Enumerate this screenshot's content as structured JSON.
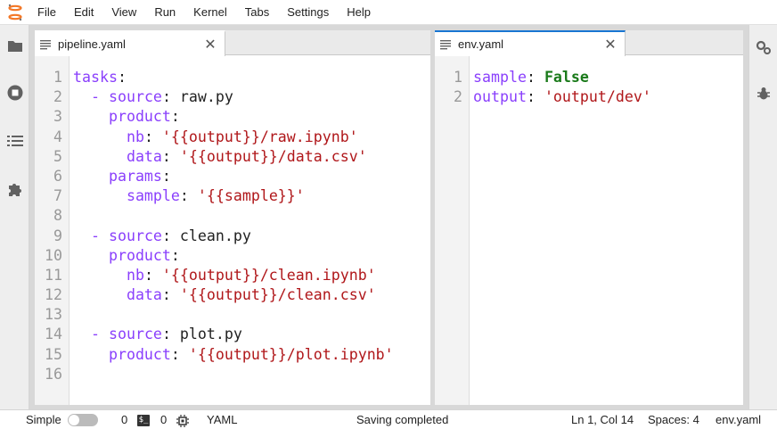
{
  "menubar": {
    "items": [
      "File",
      "Edit",
      "View",
      "Run",
      "Kernel",
      "Tabs",
      "Settings",
      "Help"
    ]
  },
  "left_sidebar": {
    "icons": [
      "folder-icon",
      "stop-circle-icon",
      "list-icon",
      "puzzle-icon"
    ]
  },
  "right_sidebar": {
    "icons": [
      "property-inspector-gears-icon",
      "debugger-bug-icon"
    ]
  },
  "colors": {
    "accent": "#1976d2",
    "keyword": "#8a3ffc",
    "string": "#b0171a",
    "boolean": "#1a7a1a",
    "logo": "#f37726"
  },
  "editors": [
    {
      "tab_label": "pipeline.yaml",
      "lines": [
        [
          [
            "k",
            "tasks"
          ],
          [
            "p",
            ":"
          ]
        ],
        [
          [
            "p",
            "  "
          ],
          [
            "dash",
            "-"
          ],
          [
            "p",
            " "
          ],
          [
            "k",
            "source"
          ],
          [
            "p",
            ": raw.py"
          ]
        ],
        [
          [
            "p",
            "    "
          ],
          [
            "k",
            "product"
          ],
          [
            "p",
            ":"
          ]
        ],
        [
          [
            "p",
            "      "
          ],
          [
            "k",
            "nb"
          ],
          [
            "p",
            ": "
          ],
          [
            "s",
            "'{{output}}/raw.ipynb'"
          ]
        ],
        [
          [
            "p",
            "      "
          ],
          [
            "k",
            "data"
          ],
          [
            "p",
            ": "
          ],
          [
            "s",
            "'{{output}}/data.csv'"
          ]
        ],
        [
          [
            "p",
            "    "
          ],
          [
            "k",
            "params"
          ],
          [
            "p",
            ":"
          ]
        ],
        [
          [
            "p",
            "      "
          ],
          [
            "k",
            "sample"
          ],
          [
            "p",
            ": "
          ],
          [
            "s",
            "'{{sample}}'"
          ]
        ],
        [],
        [
          [
            "p",
            "  "
          ],
          [
            "dash",
            "-"
          ],
          [
            "p",
            " "
          ],
          [
            "k",
            "source"
          ],
          [
            "p",
            ": clean.py"
          ]
        ],
        [
          [
            "p",
            "    "
          ],
          [
            "k",
            "product"
          ],
          [
            "p",
            ":"
          ]
        ],
        [
          [
            "p",
            "      "
          ],
          [
            "k",
            "nb"
          ],
          [
            "p",
            ": "
          ],
          [
            "s",
            "'{{output}}/clean.ipynb'"
          ]
        ],
        [
          [
            "p",
            "      "
          ],
          [
            "k",
            "data"
          ],
          [
            "p",
            ": "
          ],
          [
            "s",
            "'{{output}}/clean.csv'"
          ]
        ],
        [],
        [
          [
            "p",
            "  "
          ],
          [
            "dash",
            "-"
          ],
          [
            "p",
            " "
          ],
          [
            "k",
            "source"
          ],
          [
            "p",
            ": plot.py"
          ]
        ],
        [
          [
            "p",
            "    "
          ],
          [
            "k",
            "product"
          ],
          [
            "p",
            ": "
          ],
          [
            "s",
            "'{{output}}/plot.ipynb'"
          ]
        ],
        []
      ]
    },
    {
      "tab_label": "env.yaml",
      "lines": [
        [
          [
            "k",
            "sample"
          ],
          [
            "p",
            ": "
          ],
          [
            "b",
            "False"
          ]
        ],
        [
          [
            "k",
            "output"
          ],
          [
            "p",
            ": "
          ],
          [
            "s",
            "'output/dev'"
          ]
        ]
      ]
    }
  ],
  "statusbar": {
    "simple_label": "Simple",
    "terminals_count": "0",
    "kernels_count": "0",
    "language": "YAML",
    "message": "Saving completed",
    "cursor": "Ln 1, Col 14",
    "spaces": "Spaces: 4",
    "filename": "env.yaml"
  }
}
